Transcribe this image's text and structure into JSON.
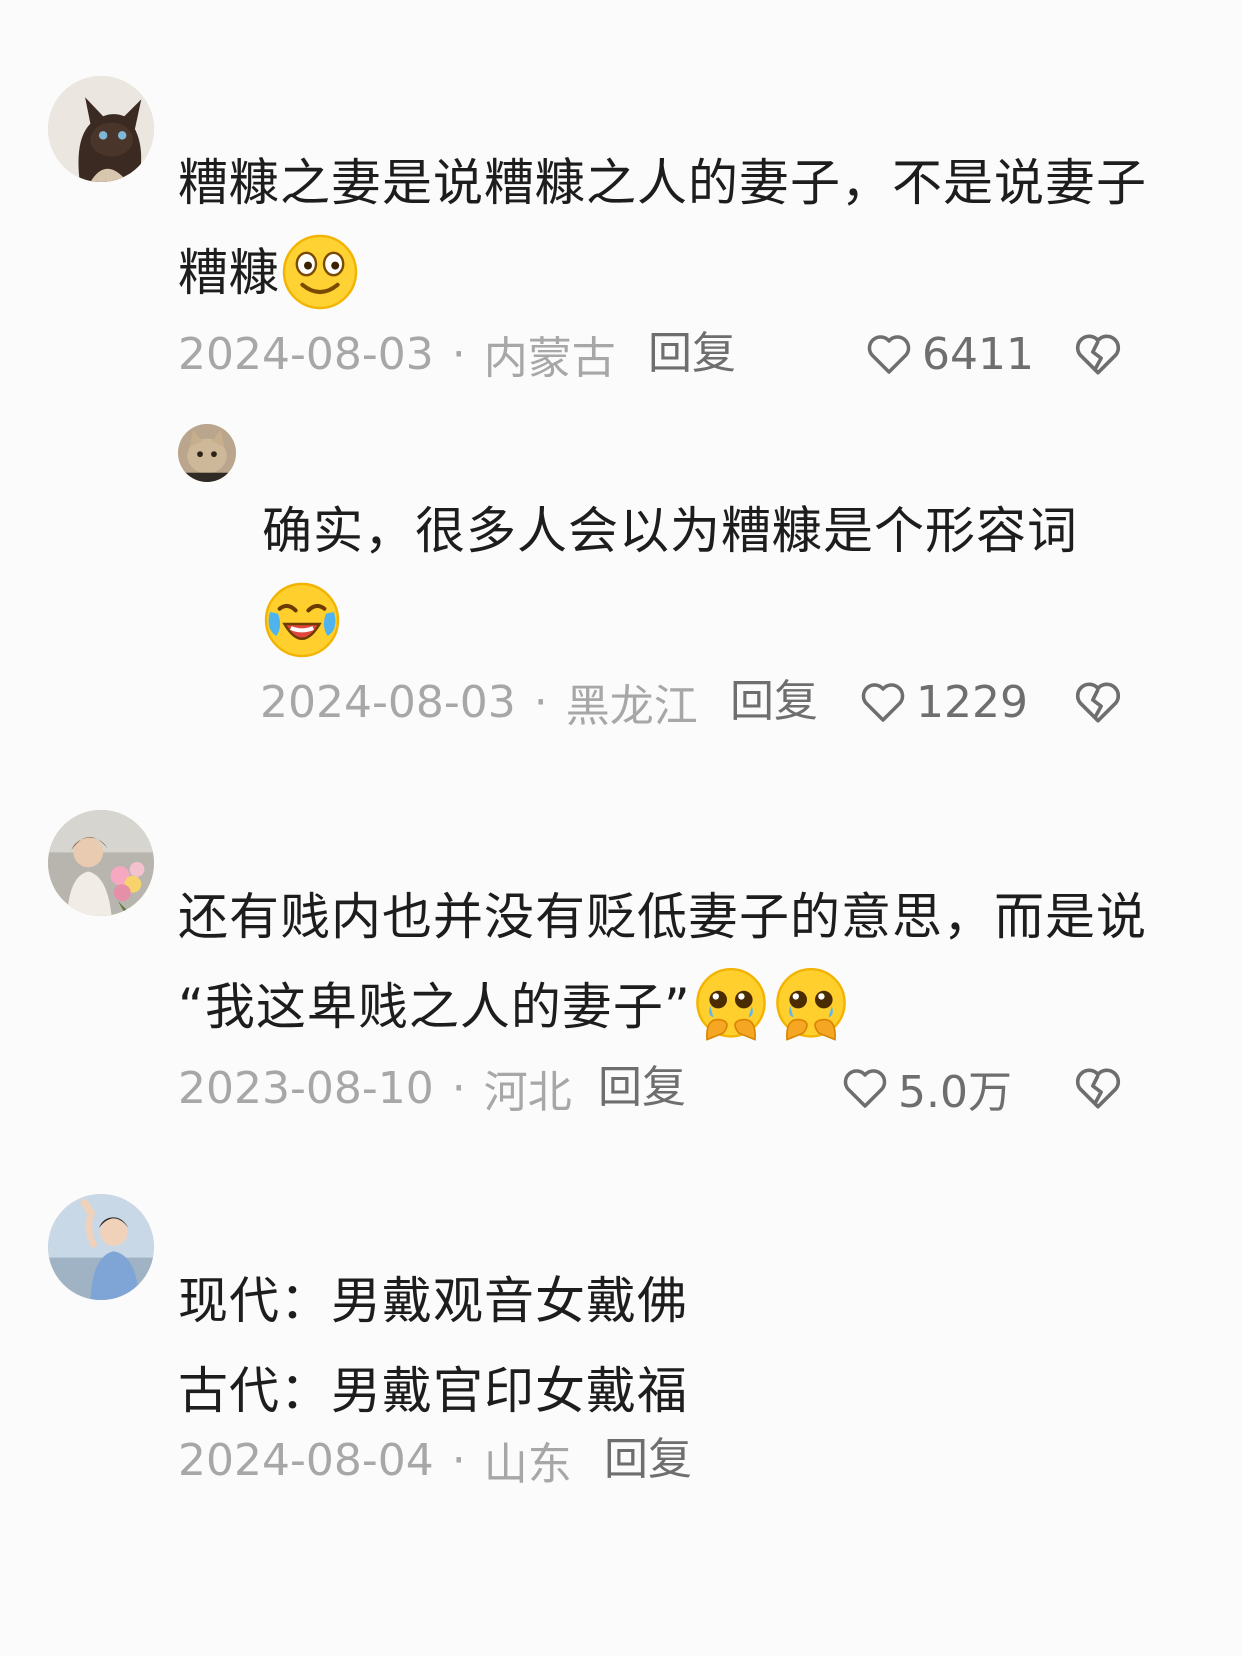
{
  "comments": [
    {
      "avatar": "siamese-cat-avatar",
      "lines": [
        "糟糠之妻是说糟糠之人的妻子，不是说妻子",
        "糟糠"
      ],
      "date": "2024-08-03",
      "location": "内蒙古",
      "reply_label": "回复",
      "likes": "6411",
      "emoji": "grinning-face-emoji"
    },
    {
      "avatar": "kitten-avatar",
      "lines": [
        "确实，很多人会以为糟糠是个形容词"
      ],
      "date": "2024-08-03",
      "location": "黑龙江",
      "reply_label": "回复",
      "likes": "1229",
      "emoji": "laughing-crying-emoji"
    },
    {
      "avatar": "girl-flowers-avatar",
      "lines": [
        "还有贱内也并没有贬低妻子的意思，而是说",
        "“我这卑贱之人的妻子”"
      ],
      "date": "2023-08-10",
      "location": "河北",
      "reply_label": "回复",
      "likes": "5.0万",
      "emoji": "pleading-face-emoji"
    },
    {
      "avatar": "person-photo-avatar",
      "lines": [
        "现代：男戴观音女戴佛",
        "古代：男戴官印女戴福"
      ],
      "date": "2024-08-04",
      "location": "山东",
      "reply_label": "回复"
    }
  ],
  "meta_separator": "·",
  "colors": {
    "text": "#1d1d1d",
    "meta": "#a7a7a7",
    "action": "#6e6e6e",
    "background": "#fbfbfb"
  }
}
